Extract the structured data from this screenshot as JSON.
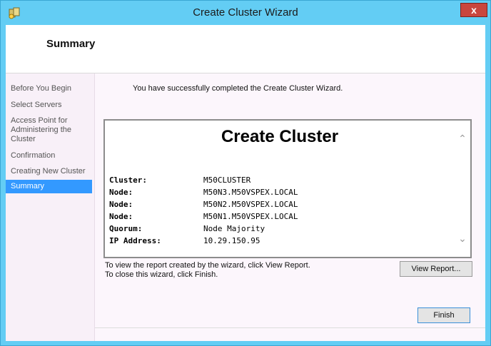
{
  "window": {
    "title": "Create Cluster Wizard",
    "close_label": "x"
  },
  "header": {
    "title": "Summary"
  },
  "nav": {
    "items": [
      {
        "label": "Before You Begin",
        "selected": false
      },
      {
        "label": "Select Servers",
        "selected": false
      },
      {
        "label": "Access Point for Administering the Cluster",
        "selected": false
      },
      {
        "label": "Confirmation",
        "selected": false
      },
      {
        "label": "Creating New Cluster",
        "selected": false
      },
      {
        "label": "Summary",
        "selected": true
      }
    ]
  },
  "main": {
    "success_message": "You have successfully completed the Create Cluster Wizard.",
    "report": {
      "title": "Create Cluster",
      "rows": [
        {
          "key": "Cluster:",
          "value": "M50CLUSTER"
        },
        {
          "key": "Node:",
          "value": "M50N3.M50VSPEX.LOCAL"
        },
        {
          "key": "Node:",
          "value": "M50N2.M50VSPEX.LOCAL"
        },
        {
          "key": "Node:",
          "value": "M50N1.M50VSPEX.LOCAL"
        },
        {
          "key": "Quorum:",
          "value": "Node Majority"
        },
        {
          "key": "IP Address:",
          "value": "10.29.150.95"
        }
      ]
    },
    "hint_line1": "To view the report created by the wizard, click View Report.",
    "hint_line2": "To close this wizard, click Finish.",
    "view_report_label": "View Report...",
    "finish_label": "Finish"
  },
  "colors": {
    "titlebar": "#63cdf4",
    "selected": "#3399ff",
    "close": "#c9463d"
  },
  "icons": {
    "app": "cluster-wizard-icon",
    "close": "close-icon",
    "scroll_up": "chevron-up-icon",
    "scroll_down": "chevron-down-icon"
  }
}
